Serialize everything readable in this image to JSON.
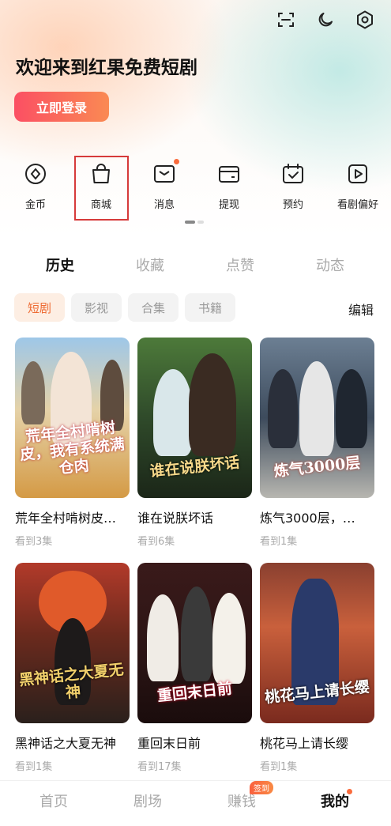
{
  "header": {
    "welcome": "欢迎来到红果免费短剧",
    "login_label": "立即登录",
    "icons": [
      "scan-icon",
      "moon-icon",
      "settings-hex-icon"
    ]
  },
  "quick_actions": [
    {
      "label": "金币",
      "icon": "coin-icon"
    },
    {
      "label": "商城",
      "icon": "shopping-bag-icon",
      "highlighted": true
    },
    {
      "label": "消息",
      "icon": "message-icon",
      "dot": true
    },
    {
      "label": "提现",
      "icon": "wallet-icon"
    },
    {
      "label": "预约",
      "icon": "calendar-check-icon"
    },
    {
      "label": "看剧偏好",
      "icon": "play-preference-icon"
    }
  ],
  "tabs": [
    "历史",
    "收藏",
    "点赞",
    "动态"
  ],
  "filters": [
    "短剧",
    "影视",
    "合集",
    "书籍"
  ],
  "edit_label": "编辑",
  "items": [
    {
      "title": "荒年全村啃树皮…",
      "progress": "看到3集",
      "poster_text": "荒年全村啃树皮，我有系统满仓肉"
    },
    {
      "title": "谁在说朕坏话",
      "progress": "看到6集",
      "poster_text": "谁在说朕坏话"
    },
    {
      "title": "炼气3000层，…",
      "progress": "看到1集",
      "poster_text": "炼气3000层"
    },
    {
      "title": "黑神话之大夏无神",
      "progress": "看到1集",
      "poster_text": "黑神话之大夏无神"
    },
    {
      "title": "重回末日前",
      "progress": "看到17集",
      "poster_text": "重回末日前"
    },
    {
      "title": "桃花马上请长缨",
      "progress": "看到1集",
      "poster_text": "桃花马上请长缨"
    }
  ],
  "bottom_nav": {
    "items": [
      "首页",
      "剧场",
      "赚钱",
      "我的"
    ],
    "badge": "签到",
    "active": "我的"
  },
  "colors": {
    "accent": "#fb4f63",
    "orange": "#ee6b33",
    "highlight_box": "#d63a3a"
  }
}
